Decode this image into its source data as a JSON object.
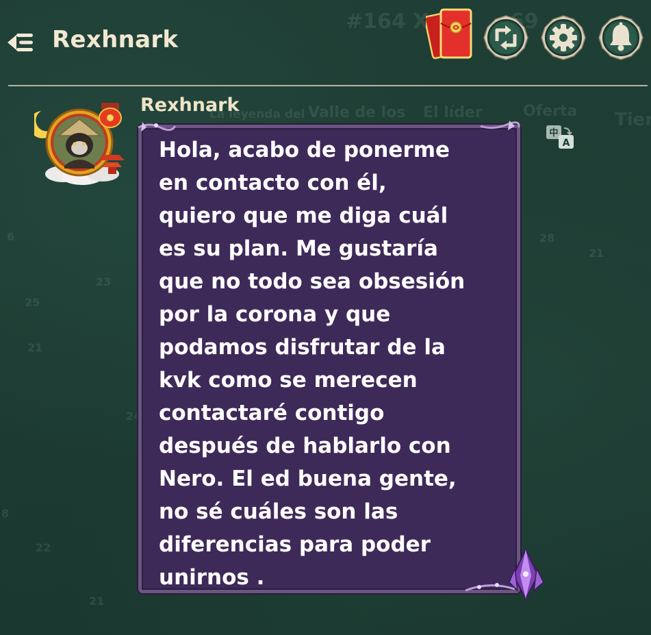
{
  "header": {
    "title": "Rexhnark",
    "back_icon": "back-list-icon",
    "buttons": [
      {
        "icon": "red-envelope-icon"
      },
      {
        "icon": "swap-icon"
      },
      {
        "icon": "gear-icon"
      },
      {
        "icon": "bell-icon"
      }
    ]
  },
  "message": {
    "sender": "Rexhnark",
    "text": "Hola, acabo de ponerme\nen contacto con él,\nquiero que me diga cuál\nes su plan. Me gustaría\nque no todo sea obsesión\npor la corona y que\npodamos disfrutar de la\nkvk como se merecen\ncontactaré contigo\ndespués de hablarlo con\nNero. El ed buena gente,\nno sé cuáles son las\ndiferencias para poder\nunirnos .",
    "translate_icon": "translate-icon",
    "translate_glyphs": {
      "source": "中",
      "target": "A"
    }
  },
  "background": {
    "map_label": "#164 X:",
    "map_coord_tail": "69",
    "banners": [
      "La leyenda del",
      "Valle de los",
      "El líder",
      "Oferta",
      "Tier"
    ],
    "numbers": [
      "6",
      "23",
      "25",
      "21",
      "28",
      "21",
      "22",
      "21",
      "24",
      "8"
    ]
  },
  "colors": {
    "background": "#1d3a32",
    "bubble": "#3e2a59",
    "bubble_border": "#6a5680",
    "title_text": "#f2e8d2",
    "button_ring": "#cfc6ae",
    "button_fill": "#2a5848",
    "envelope_red": "#d62a22"
  }
}
